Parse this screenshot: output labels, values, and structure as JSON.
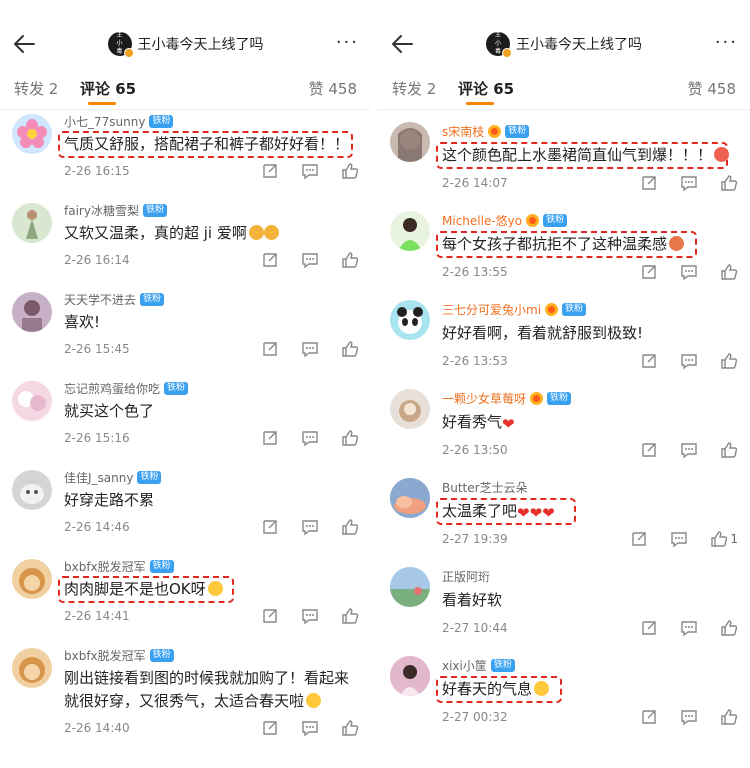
{
  "post": {
    "title": "王小毒今天上线了吗",
    "avatar_text": "王小毒"
  },
  "tabs": {
    "reposts": "转发 2",
    "comments": "评论 65",
    "likes": "赞 458"
  },
  "badge": "铁粉",
  "left_comments": [
    {
      "user": "小七_77sunny",
      "text": "气质又舒服，搭配裙子和裤子都好好看！！",
      "time": "2-26 16:15",
      "highlighted": true
    },
    {
      "user": "fairy冰糖雪梨",
      "text": "又软又温柔，真的超 ji 爱啊",
      "time": "2-26 16:14",
      "highlighted": false
    },
    {
      "user": "天天学不进去",
      "text": "喜欢!",
      "time": "2-26 15:45",
      "highlighted": false
    },
    {
      "user": "忘记煎鸡蛋给你吃",
      "text": "就买这个色了",
      "time": "2-26 15:16",
      "highlighted": false
    },
    {
      "user": "佳佳J_sanny",
      "text": "好穿走路不累",
      "time": "2-26 14:46",
      "highlighted": false
    },
    {
      "user": "bxbfx脱发冠军",
      "text": "肉肉脚是不是也OK呀",
      "time": "2-26 14:41",
      "highlighted": true
    },
    {
      "user": "bxbfx脱发冠军",
      "text": "刚出链接看到图的时候我就加购了！看起来就很好穿，又很秀气，太适合春天啦",
      "time": "2-26 14:40",
      "highlighted": false
    }
  ],
  "right_comments": [
    {
      "user": "s宋南枝",
      "text": "这个颜色配上水墨裙简直仙气到爆！！！",
      "time": "2-26 14:07",
      "highlighted": true
    },
    {
      "user": "Michelle-悠yo",
      "text": "每个女孩子都抗拒不了这种温柔感",
      "time": "2-26 13:55",
      "highlighted": true
    },
    {
      "user": "三七分可爱兔小mi",
      "text": "好好看啊，看着就舒服到极致!",
      "time": "2-26 13:53",
      "highlighted": false
    },
    {
      "user": "一颗少女草莓呀",
      "text": "好看秀气",
      "time": "2-26 13:50",
      "highlighted": false
    },
    {
      "user": "Butter芝士云朵",
      "text": "太温柔了吧",
      "time": "2-27 19:39",
      "highlighted": true,
      "likes": "1"
    },
    {
      "user": "正版阿珩",
      "text": "看着好软",
      "time": "2-27 10:44",
      "highlighted": false
    },
    {
      "user": "xixi小筐",
      "text": "好春天的气息",
      "time": "2-27 00:32",
      "highlighted": true
    }
  ],
  "colors": {
    "accent": "#ff8200",
    "highlight_border": "#e0281e",
    "fan_badge": "#3aa0f0",
    "vip_name": "#f07020"
  },
  "icons": [
    "back-arrow-icon",
    "more-icon",
    "share-icon",
    "comment-icon",
    "like-icon",
    "flower-icon",
    "heart-icon",
    "emoji-icon",
    "crown-badge-icon"
  ]
}
